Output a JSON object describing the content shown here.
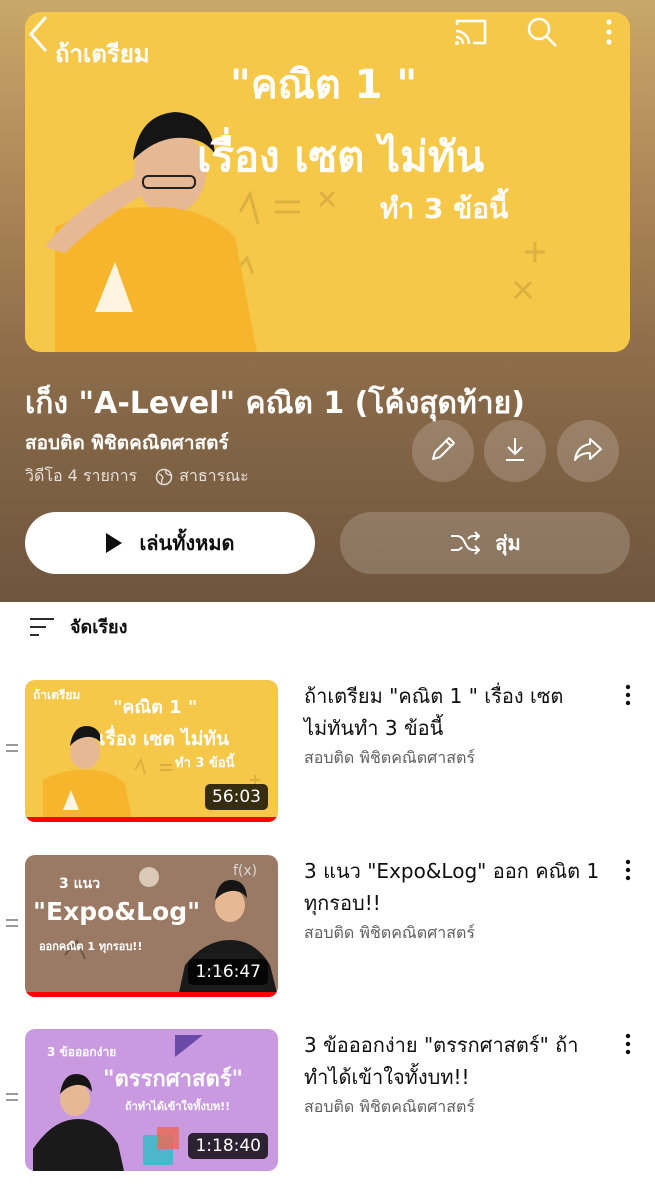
{
  "header": {
    "back_icon": "chevron-left-icon",
    "cast_icon": "cast-icon",
    "search_icon": "search-icon",
    "more_icon": "more-vertical-icon"
  },
  "playlist": {
    "thumb_text": {
      "line_top": "ถ้าเตรียม",
      "line1": "\"คณิต 1 \"",
      "line2": "เรื่อง เซต ไม่ทัน",
      "line3": "ทำ 3 ข้อนี้"
    },
    "title": "เก็ง \"A-Level\" คณิต 1 (โค้งสุดท้าย)",
    "owner": "สอบติด พิชิตคณิตศาสตร์",
    "video_count": "วิดีโอ 4 รายการ",
    "privacy": "สาธารณะ",
    "play_all_label": "เล่นทั้งหมด",
    "shuffle_label": "สุ่ม",
    "sort_label": "จัดเรียง"
  },
  "videos": [
    {
      "title": "ถ้าเตรียม \"คณิต 1 \" เรื่อง เซต ไม่ทันทำ 3 ข้อนี้",
      "channel": "สอบติด พิชิตคณิตศาสตร์",
      "duration": "56:03",
      "watched_fraction": 1.0,
      "thumb": {
        "t0": "ถ้าเตรียม",
        "t1": "\"คณิต 1 \"",
        "t2": "เรื่อง เซต ไม่ทัน",
        "t3": "ทำ 3 ข้อนี้"
      }
    },
    {
      "title": "3 แนว \"Expo&Log\" ออก คณิต 1 ทุกรอบ!!",
      "channel": "สอบติด พิชิตคณิตศาสตร์",
      "duration": "1:16:47",
      "watched_fraction": 1.0,
      "thumb": {
        "t0": "3 แนว",
        "t1": "\"Expo&Log\"",
        "t2": "ออกคณิต 1 ทุกรอบ!!",
        "t3": "f(x)"
      }
    },
    {
      "title": "3 ข้อออกง่าย \"ตรรกศาสตร์\" ถ้าทำได้เข้าใจทั้งบท!!",
      "channel": "สอบติด พิชิตคณิตศาสตร์",
      "duration": "1:18:40",
      "watched_fraction": 0.0,
      "thumb": {
        "t0": "3 ข้อออกง่าย",
        "t1": "\"ตรรกศาสตร์\"",
        "t2": "ถ้าทำได้เข้าใจทั้งบท!!",
        "t3": ""
      }
    }
  ],
  "colors": {
    "accent_red": "#ff0000",
    "hero_bg": "#a88355",
    "thumb_yellow": "#f6c84a",
    "thumb_brown": "#9a7a64",
    "thumb_purple": "#c99ae0"
  }
}
